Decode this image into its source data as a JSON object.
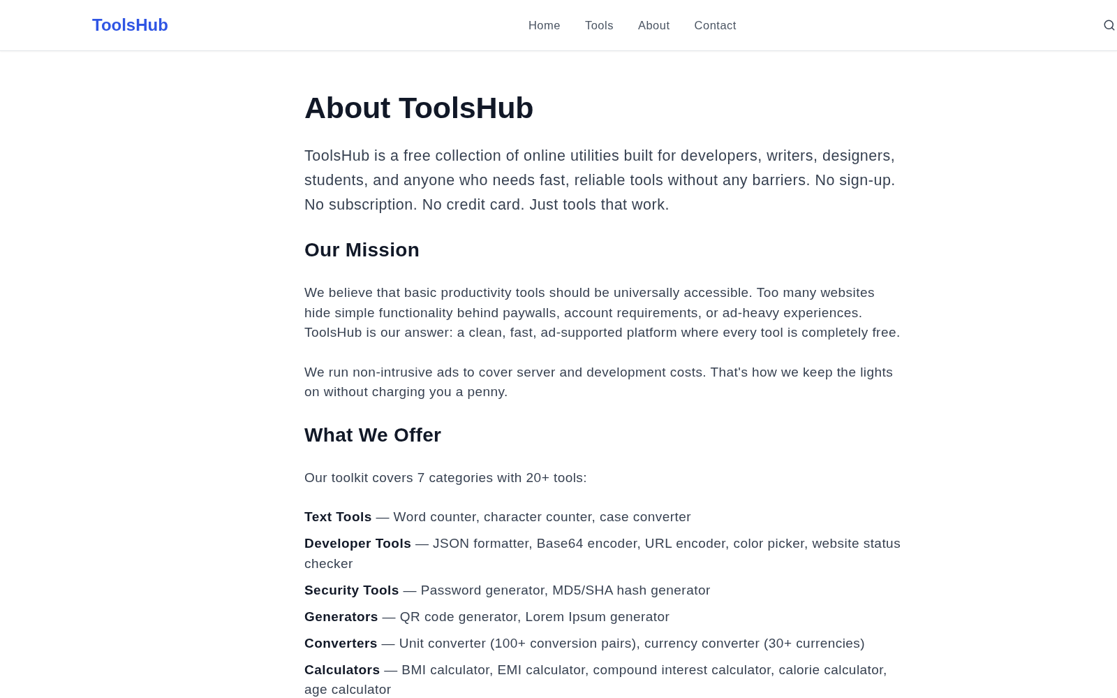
{
  "header": {
    "logo": "ToolsHub",
    "nav": [
      "Home",
      "Tools",
      "About",
      "Contact"
    ]
  },
  "page": {
    "title": "About ToolsHub",
    "intro": "ToolsHub is a free collection of online utilities built for developers, writers, designers, students, and anyone who needs fast, reliable tools without any barriers. No sign-up. No subscription. No credit card. Just tools that work.",
    "sections": [
      {
        "heading": "Our Mission",
        "paragraphs": [
          "We believe that basic productivity tools should be universally accessible. Too many websites hide simple functionality behind paywalls, account requirements, or ad-heavy experiences. ToolsHub is our answer: a clean, fast, ad-supported platform where every tool is completely free.",
          "We run non-intrusive ads to cover server and development costs. That's how we keep the lights on without charging you a penny."
        ]
      },
      {
        "heading": "What We Offer",
        "paragraphs": [
          "Our toolkit covers 7 categories with 20+ tools:"
        ],
        "list": [
          "**Text Tools** — Word counter, character counter, case converter",
          "**Developer Tools** — JSON formatter, Base64 encoder, URL encoder, color picker, website status checker",
          "**Security Tools** — Password generator, MD5/SHA hash generator",
          "**Generators** — QR code generator, Lorem Ipsum generator",
          "**Converters** — Unit converter (100+ conversion pairs), currency converter (30+ currencies)",
          "**Calculators** — BMI calculator, EMI calculator, compound interest calculator, calorie calculator, age calculator"
        ]
      }
    ]
  }
}
